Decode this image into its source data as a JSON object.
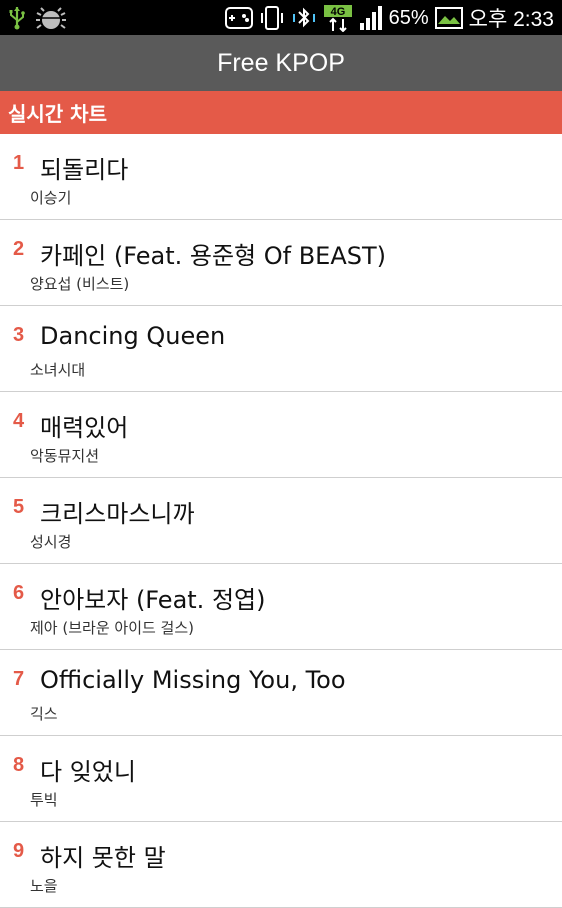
{
  "status_bar": {
    "battery_percent": "65%",
    "time": "오후 2:33",
    "network_label": "4G",
    "icons": [
      "usb-icon",
      "debug-bug-icon",
      "gamepad-icon",
      "phone-vibrate-icon",
      "bluetooth-icon",
      "network-4g-icon",
      "signal-icon",
      "battery-icon",
      "image-notification-icon"
    ]
  },
  "app": {
    "title": "Free KPOP"
  },
  "section": {
    "title": "실시간 차트"
  },
  "colors": {
    "accent": "#e45a48",
    "title_bar": "#5a5a5a"
  },
  "chart_items": [
    {
      "rank": "1",
      "title": "되돌리다",
      "artist": "이승기"
    },
    {
      "rank": "2",
      "title": "카페인 (Feat. 용준형 Of BEAST)",
      "artist": "양요섭 (비스트)"
    },
    {
      "rank": "3",
      "title": "Dancing Queen",
      "artist": "소녀시대"
    },
    {
      "rank": "4",
      "title": "매력있어",
      "artist": "악동뮤지션"
    },
    {
      "rank": "5",
      "title": "크리스마스니까",
      "artist": "성시경"
    },
    {
      "rank": "6",
      "title": "안아보자 (Feat. 정엽)",
      "artist": "제아 (브라운 아이드 걸스)"
    },
    {
      "rank": "7",
      "title": "Officially Missing You, Too",
      "artist": "긱스"
    },
    {
      "rank": "8",
      "title": "다 잊었니",
      "artist": "투빅"
    },
    {
      "rank": "9",
      "title": "하지 못한 말",
      "artist": "노을"
    }
  ]
}
